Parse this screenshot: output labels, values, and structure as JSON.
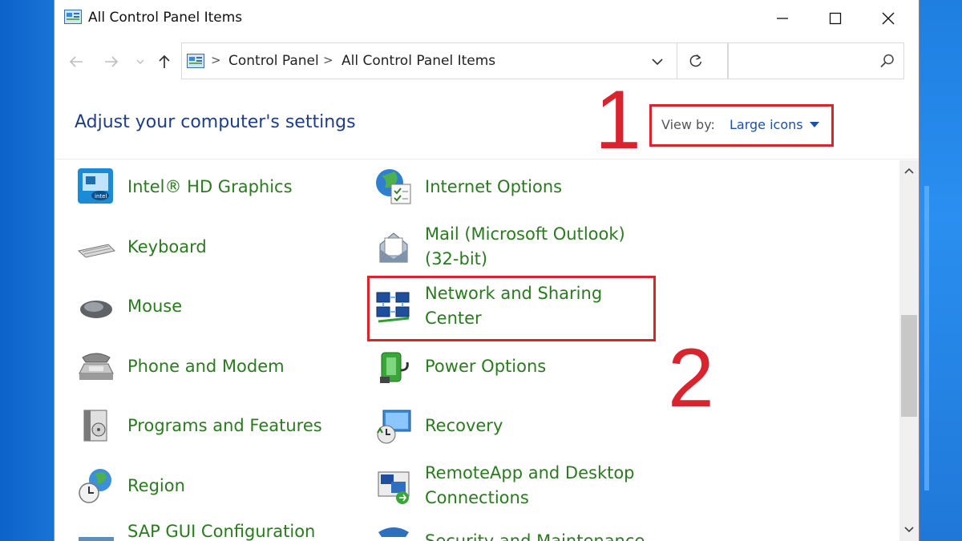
{
  "window": {
    "title": "All Control Panel Items"
  },
  "address_bar": {
    "crumbs": [
      "Control Panel",
      "All Control Panel Items"
    ],
    "separator": ">"
  },
  "search": {
    "placeholder": ""
  },
  "header": {
    "title": "Adjust your computer's settings",
    "view_by_label": "View by:",
    "view_by_value": "Large icons"
  },
  "annotations": {
    "num1": "1",
    "num2": "2",
    "color": "#d8242e"
  },
  "items_left": [
    {
      "label": "Intel® HD Graphics",
      "icon": "intel-graphics-icon"
    },
    {
      "label": "Keyboard",
      "icon": "keyboard-icon"
    },
    {
      "label": "Mouse",
      "icon": "mouse-icon"
    },
    {
      "label": "Phone and Modem",
      "icon": "phone-icon"
    },
    {
      "label": "Programs and Features",
      "icon": "programs-icon"
    },
    {
      "label": "Region",
      "icon": "region-icon"
    },
    {
      "label": "SAP GUI Configuration",
      "icon": "sap-icon"
    }
  ],
  "items_right": [
    {
      "label": "Internet Options",
      "icon": "internet-options-icon"
    },
    {
      "label": "Mail (Microsoft Outlook) (32-bit)",
      "icon": "mail-icon"
    },
    {
      "label": "Network and Sharing Center",
      "icon": "network-icon"
    },
    {
      "label": "Power Options",
      "icon": "power-icon"
    },
    {
      "label": "Recovery",
      "icon": "recovery-icon"
    },
    {
      "label": "RemoteApp and Desktop Connections",
      "icon": "remoteapp-icon"
    },
    {
      "label": "Security and Maintenance",
      "icon": "security-icon"
    }
  ],
  "colors": {
    "link_green": "#2a7a1f",
    "heading_blue": "#1e3e8a"
  }
}
